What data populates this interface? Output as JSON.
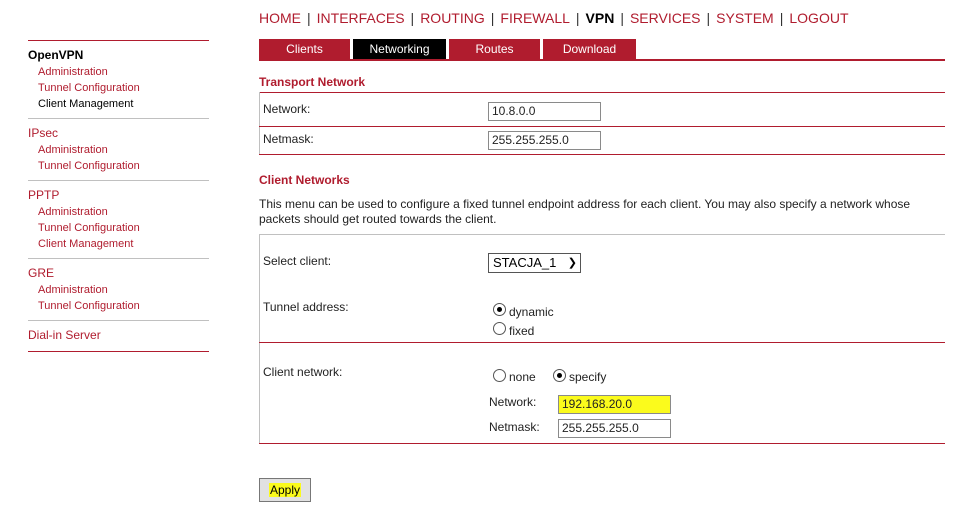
{
  "topnav": {
    "items": [
      {
        "label": "HOME"
      },
      {
        "label": "INTERFACES"
      },
      {
        "label": "ROUTING"
      },
      {
        "label": "FIREWALL"
      },
      {
        "label": "VPN"
      },
      {
        "label": "SERVICES"
      },
      {
        "label": "SYSTEM"
      },
      {
        "label": "LOGOUT"
      }
    ],
    "separator": "|",
    "active": "VPN"
  },
  "sidebar": {
    "groups": [
      {
        "title": "OpenVPN",
        "items": [
          "Administration",
          "Tunnel Configuration",
          "Client Management"
        ]
      },
      {
        "title": "IPsec",
        "items": [
          "Administration",
          "Tunnel Configuration"
        ]
      },
      {
        "title": "PPTP",
        "items": [
          "Administration",
          "Tunnel Configuration",
          "Client Management"
        ]
      },
      {
        "title": "GRE",
        "items": [
          "Administration",
          "Tunnel Configuration"
        ]
      },
      {
        "title": "Dial-in Server",
        "items": []
      }
    ]
  },
  "tabs": [
    {
      "label": "Clients"
    },
    {
      "label": "Networking"
    },
    {
      "label": "Routes"
    },
    {
      "label": "Download"
    }
  ],
  "transport": {
    "title": "Transport Network",
    "network_label": "Network:",
    "network_value": "10.8.0.0",
    "netmask_label": "Netmask:",
    "netmask_value": "255.255.255.0"
  },
  "client_networks": {
    "title": "Client Networks",
    "description": "This menu can be used to configure a fixed tunnel endpoint address for each client. You may also specify a network whose packets should get routed towards the client.",
    "select_label": "Select client:",
    "select_value": "STACJA_1",
    "tunnel_label": "Tunnel address:",
    "tunnel_opt_dynamic": "dynamic",
    "tunnel_opt_fixed": "fixed",
    "client_network_label": "Client network:",
    "cn_opt_none": "none",
    "cn_opt_specify": "specify",
    "cn_network_label": "Network:",
    "cn_network_value": "192.168.20.0",
    "cn_netmask_label": "Netmask:",
    "cn_netmask_value": "255.255.255.0"
  },
  "apply_label": "Apply",
  "colors": {
    "accent": "#b01c2e",
    "highlight": "#fbfb1c"
  }
}
